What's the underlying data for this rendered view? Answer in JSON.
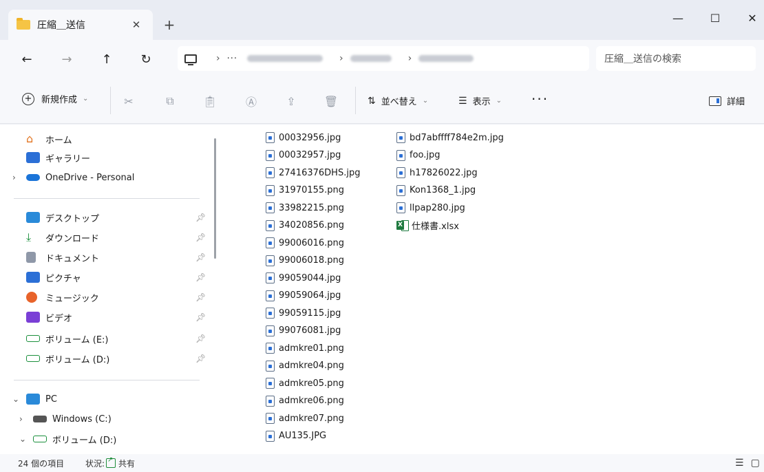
{
  "window": {
    "tab_title": "圧縮＿送信",
    "tab_close": "✕",
    "new_tab": "+",
    "minimize": "—",
    "maximize": "☐",
    "close": "✕"
  },
  "address": {
    "back": "←",
    "forward": "→",
    "up": "↑",
    "refresh": "↻",
    "separator": "›",
    "more": "···",
    "search_placeholder": "圧縮＿送信の検索"
  },
  "toolbar": {
    "new_label": "新規作成",
    "sort_label": "並べ替え",
    "view_label": "表示",
    "more": "···",
    "details_label": "詳細",
    "chevron": "⌄"
  },
  "nav": {
    "home": "ホーム",
    "gallery": "ギャラリー",
    "onedrive": "OneDrive - Personal",
    "desktop": "デスクトップ",
    "downloads": "ダウンロード",
    "documents": "ドキュメント",
    "pictures": "ピクチャ",
    "music": "ミュージック",
    "videos": "ビデオ",
    "volume_e": "ボリューム (E:)",
    "volume_d": "ボリューム (D:)",
    "pc": "PC",
    "windows_c": "Windows (C:)",
    "volume_d2": "ボリューム (D:)"
  },
  "files": {
    "col1": [
      "00032956.jpg",
      "00032957.jpg",
      "27416376DHS.jpg",
      "31970155.png",
      "33982215.png",
      "34020856.png",
      "99006016.png",
      "99006018.png",
      "99059044.jpg",
      "99059064.jpg",
      "99059115.jpg",
      "99076081.jpg",
      "admkre01.png",
      "admkre04.png",
      "admkre05.png",
      "admkre06.png",
      "admkre07.png",
      "AU135.JPG"
    ],
    "col2": [
      "bd7abffff784e2m.jpg",
      "foo.jpg",
      "h17826022.jpg",
      "Kon1368_1.jpg",
      "llpap280.jpg",
      "仕様書.xlsx"
    ]
  },
  "status": {
    "count": "24 個の項目",
    "state_label": "状況:",
    "state_value": "共有"
  },
  "colors": {
    "accent": "#2b6fd6",
    "folder": "#f5c445",
    "excel": "#1e7a3f"
  }
}
